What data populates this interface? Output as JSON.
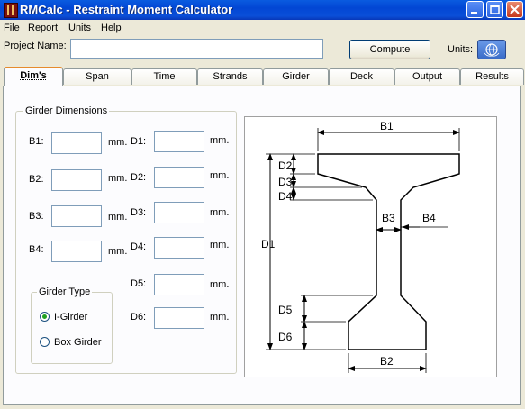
{
  "window": {
    "title": "RMCalc - Restraint Moment Calculator"
  },
  "menu": [
    "File",
    "Report",
    "Units",
    "Help"
  ],
  "project": {
    "label": "Project Name:",
    "value": "",
    "compute_label": "Compute",
    "units_label": "Units:"
  },
  "tabs": [
    "Dim's",
    "Span",
    "Time",
    "Strands",
    "Girder",
    "Deck",
    "Output",
    "Results"
  ],
  "active_tab": "Dim's",
  "girder_dimensions": {
    "title": "Girder Dimensions",
    "unit": "mm.",
    "b_fields": [
      {
        "label": "B1:",
        "value": ""
      },
      {
        "label": "B2:",
        "value": ""
      },
      {
        "label": "B3:",
        "value": ""
      },
      {
        "label": "B4:",
        "value": ""
      }
    ],
    "d_fields": [
      {
        "label": "D1:",
        "value": ""
      },
      {
        "label": "D2:",
        "value": ""
      },
      {
        "label": "D3:",
        "value": ""
      },
      {
        "label": "D4:",
        "value": ""
      },
      {
        "label": "D5:",
        "value": ""
      },
      {
        "label": "D6:",
        "value": ""
      }
    ]
  },
  "girder_type": {
    "title": "Girder Type",
    "options": [
      {
        "label": "I-Girder",
        "selected": true
      },
      {
        "label": "Box Girder",
        "selected": false
      }
    ]
  },
  "diagram_labels": {
    "b1": "B1",
    "b2": "B2",
    "b3": "B3",
    "b4": "B4",
    "d1": "D1",
    "d2": "D2",
    "d3": "D3",
    "d4": "D4",
    "d5": "D5",
    "d6": "D6"
  },
  "colors": {
    "titlebar": "#0a4fd8",
    "tab_highlight": "#e68b2c",
    "window_bg": "#ece9d8"
  }
}
